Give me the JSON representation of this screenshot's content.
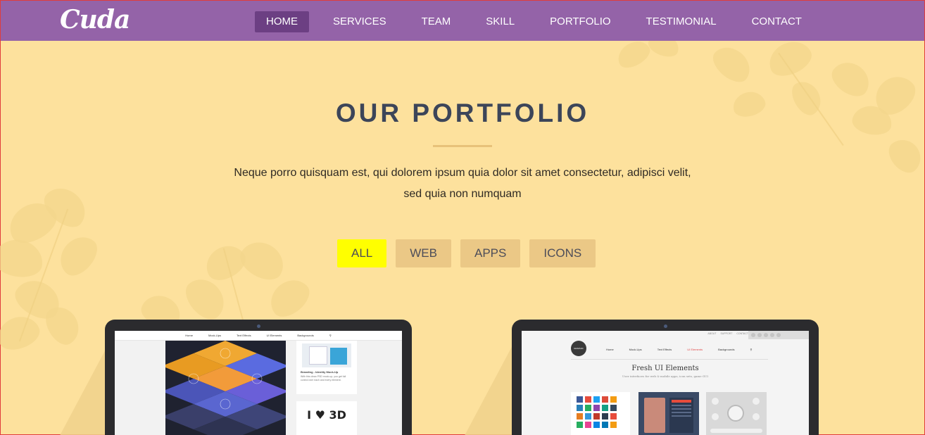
{
  "brand": {
    "logo_text": "Cuda"
  },
  "nav": {
    "items": [
      "HOME",
      "SERVICES",
      "TEAM",
      "SKILL",
      "PORTFOLIO",
      "TESTIMONIAL",
      "CONTACT"
    ],
    "active": "HOME"
  },
  "portfolio": {
    "title": "OUR PORTFOLIO",
    "description_line1": "Neque porro quisquam est, qui dolorem ipsum quia dolor sit amet consectetur, adipisci velit,",
    "description_line2": "sed quia non numquam",
    "filters": [
      "ALL",
      "WEB",
      "APPS",
      "ICONS"
    ],
    "active_filter": "ALL"
  },
  "items": [
    {
      "mini_nav": [
        "Home",
        "Mock-Ups",
        "Text Effects",
        "UI Elements",
        "Backgrounds"
      ],
      "card_title": "Branding - Identity Mock-Up",
      "card_sub": "With this clean PSD mock-up, you get full control over each and every element.",
      "badge_text": "I ♥ 3D"
    },
    {
      "mini_nav": [
        "Home",
        "Mock-Ups",
        "Text Effects",
        "UI Elements",
        "Backgrounds"
      ],
      "top_links": [
        "ABOUT",
        "SUPPORT",
        "CONTACT"
      ],
      "logo_text": "GRAPHIC BURGER",
      "heading": "Fresh UI Elements",
      "subheading": "User interfaces for web & mobile apps, icon sets, game GUI"
    }
  ],
  "colors": {
    "navbar": "#9463a8",
    "nav_active": "#6c3f83",
    "background": "#fde19d",
    "filter_bg": "#ebc886",
    "filter_active": "#ffff00",
    "title": "#3c4559"
  }
}
